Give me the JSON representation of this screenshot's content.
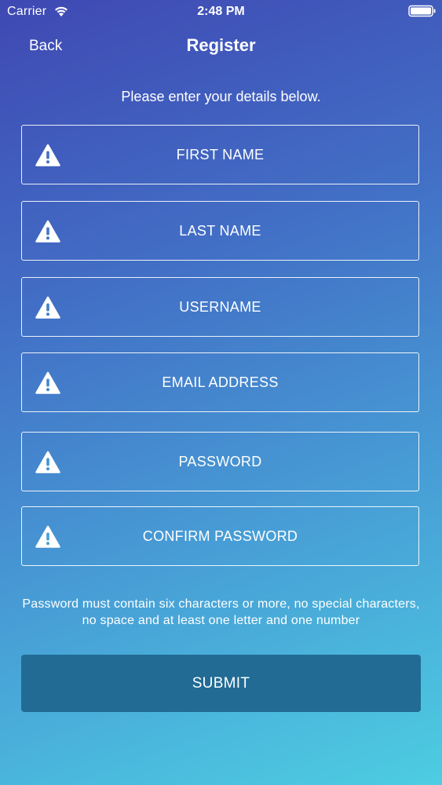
{
  "status_bar": {
    "carrier": "Carrier",
    "time": "2:48 PM",
    "wifi_icon": "wifi-icon",
    "battery_icon": "battery-icon"
  },
  "nav": {
    "back_label": "Back",
    "title": "Register"
  },
  "instructions": "Please enter your details below.",
  "fields": [
    {
      "label": "FIRST NAME",
      "icon": "warning-icon"
    },
    {
      "label": "LAST NAME",
      "icon": "warning-icon"
    },
    {
      "label": "USERNAME",
      "icon": "warning-icon"
    },
    {
      "label": "EMAIL ADDRESS",
      "icon": "warning-icon"
    },
    {
      "label": "PASSWORD",
      "icon": "warning-icon"
    },
    {
      "label": "CONFIRM PASSWORD",
      "icon": "warning-icon"
    }
  ],
  "hint": "Password must contain six characters or more, no special characters, no space and at least one letter and one number",
  "submit_label": "SUBMIT",
  "colors": {
    "gradient_top": "#3f48b3",
    "gradient_bottom": "#4dcde2",
    "submit_bg": "#216b95",
    "text": "#ffffff"
  }
}
